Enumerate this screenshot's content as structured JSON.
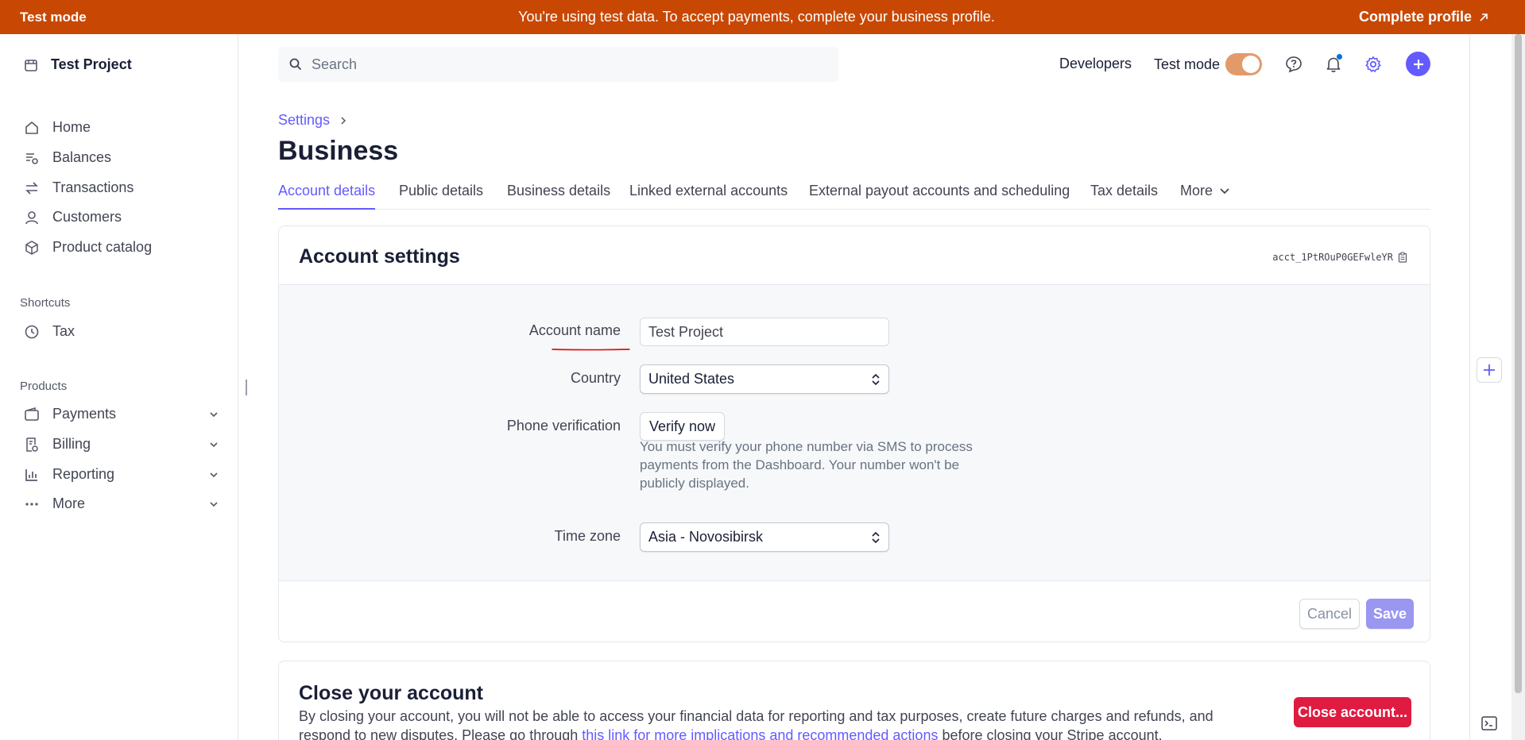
{
  "banner": {
    "mode": "Test mode",
    "message": "You're using test data. To accept payments, complete your business profile.",
    "cta": "Complete profile",
    "color": "#c84803"
  },
  "sidebar": {
    "project": "Test Project",
    "items": [
      {
        "label": "Home",
        "icon": "home-icon"
      },
      {
        "label": "Balances",
        "icon": "balances-icon"
      },
      {
        "label": "Transactions",
        "icon": "transactions-icon"
      },
      {
        "label": "Customers",
        "icon": "person-icon"
      },
      {
        "label": "Product catalog",
        "icon": "box-icon"
      }
    ],
    "shortcuts_label": "Shortcuts",
    "shortcuts": [
      {
        "label": "Tax",
        "icon": "clock-icon"
      }
    ],
    "products_label": "Products",
    "products": [
      {
        "label": "Payments",
        "icon": "wallet-icon"
      },
      {
        "label": "Billing",
        "icon": "billing-icon"
      },
      {
        "label": "Reporting",
        "icon": "chart-icon"
      },
      {
        "label": "More",
        "icon": "dots-icon"
      }
    ]
  },
  "topbar": {
    "search_placeholder": "Search",
    "developers": "Developers",
    "test_mode": "Test mode",
    "test_mode_on": true,
    "accent": "#635bff"
  },
  "breadcrumb": {
    "parent": "Settings"
  },
  "page_title": "Business",
  "tabs": [
    {
      "label": "Account details",
      "active": true
    },
    {
      "label": "Public details"
    },
    {
      "label": "Business details"
    },
    {
      "label": "Linked external accounts"
    },
    {
      "label": "External payout accounts and scheduling"
    },
    {
      "label": "Tax details"
    },
    {
      "label": "More"
    }
  ],
  "account_settings": {
    "title": "Account settings",
    "account_id": "acct_1PtROuP0GEFwleYR",
    "fields": {
      "account_name_label": "Account name",
      "account_name_value": "Test Project",
      "country_label": "Country",
      "country_value": "United States",
      "phone_label": "Phone verification",
      "phone_button": "Verify now",
      "phone_help": "You must verify your phone number via SMS to process payments from the Dashboard. Your number won't be publicly displayed.",
      "timezone_label": "Time zone",
      "timezone_value": "Asia - Novosibirsk"
    },
    "cancel": "Cancel",
    "save": "Save"
  },
  "close_account": {
    "title": "Close your account",
    "desc_before": "By closing your account, you will not be able to access your financial data for reporting and tax purposes, create future charges and refunds, and respond to new disputes. Please go through ",
    "link": "this link for more implications and recommended actions",
    "desc_after": " before closing your Stripe account.",
    "button": "Close account...",
    "danger": "#df1b41"
  }
}
